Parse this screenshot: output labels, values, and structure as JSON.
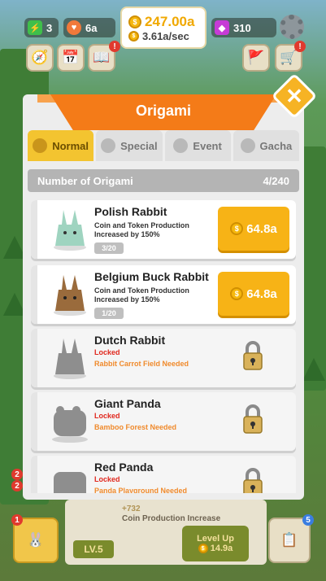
{
  "hud": {
    "energy": "3",
    "hearts": "6a",
    "gems": "310",
    "money_total": "247.00a",
    "money_rate": "3.61a/sec",
    "left_buttons_badge": "!",
    "right_buttons_badge": "!"
  },
  "dialog": {
    "title": "Origami",
    "close_label": "✕",
    "tabs": [
      {
        "label": "Normal",
        "active": true
      },
      {
        "label": "Special",
        "active": false
      },
      {
        "label": "Event",
        "active": false
      },
      {
        "label": "Gacha",
        "active": false
      }
    ],
    "count_label": "Number of Origami",
    "count_value": "4/240",
    "items": [
      {
        "name": "Polish Rabbit",
        "desc": "Coin and Token Production Increased by 150%",
        "level": "3/20",
        "price": "64.8a",
        "locked": false,
        "color": "#9fd4c0"
      },
      {
        "name": "Belgium Buck Rabbit",
        "desc": "Coin and Token Production Increased by 150%",
        "level": "1/20",
        "price": "64.8a",
        "locked": false,
        "color": "#9a6b3c"
      },
      {
        "name": "Dutch Rabbit",
        "locked_label": "Locked",
        "need": "Rabbit Carrot Field Needed",
        "locked": true
      },
      {
        "name": "Giant Panda",
        "locked_label": "Locked",
        "need": "Bamboo Forest Needed",
        "locked": true
      },
      {
        "name": "Red Panda",
        "locked_label": "Locked",
        "need": "Panda Playground Needed",
        "locked": true
      }
    ]
  },
  "bottom": {
    "bonus": "+732",
    "bonus_desc": "Coin Production Increase",
    "level": "LV.5",
    "upgrade_label": "Level Up",
    "upgrade_price": "14.9a",
    "left_badge_1": "2",
    "left_badge_2": "2",
    "left_badge_3": "1",
    "right_badge": "5"
  },
  "colors": {
    "accent_orange": "#f47b18",
    "buy_yellow": "#f7b316",
    "locked_red": "#e0271d",
    "need_orange": "#f08a2c"
  }
}
